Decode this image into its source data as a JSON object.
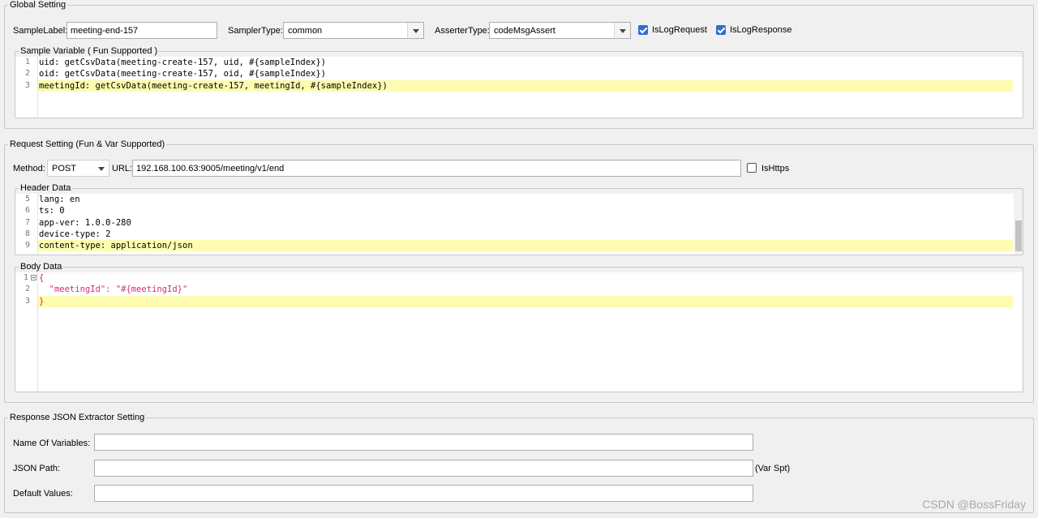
{
  "global": {
    "title": "Global Setting",
    "sample_label": {
      "label": "SampleLabel:",
      "value": "meeting-end-157"
    },
    "sampler_type": {
      "label": "SamplerType:",
      "value": "common"
    },
    "asserter_type": {
      "label": "AsserterType:",
      "value": "codeMsgAssert"
    },
    "is_log_request": {
      "label": "IsLogRequest",
      "checked": true
    },
    "is_log_response": {
      "label": "IsLogResponse",
      "checked": true
    },
    "sample_variable": {
      "title": "Sample Variable ( Fun Supported )",
      "line_numbers": [
        "1",
        "2",
        "3"
      ],
      "lines": [
        "uid: getCsvData(meeting-create-157, uid, #{sampleIndex})",
        "oid: getCsvData(meeting-create-157, oid, #{sampleIndex})",
        "meetingId: getCsvData(meeting-create-157, meetingId, #{sampleIndex})"
      ]
    }
  },
  "request": {
    "title": "Request Setting (Fun & Var Supported)",
    "method": {
      "label": "Method:",
      "value": "POST"
    },
    "url": {
      "label": "URL:",
      "value": "192.168.100.63:9005/meeting/v1/end"
    },
    "is_https": {
      "label": "IsHttps",
      "checked": false
    },
    "header_data": {
      "title": "Header Data",
      "line_numbers": [
        "5",
        "6",
        "7",
        "8",
        "9"
      ],
      "lines": [
        "lang: en",
        "ts: 0",
        "app-ver: 1.0.0-280",
        "device-type: 2",
        "content-type: application/json"
      ]
    },
    "body_data": {
      "title": "Body Data",
      "line_numbers": [
        "1",
        "2",
        "3"
      ],
      "lines": [
        "{",
        "  \"meetingId\": \"#{meetingId}\"",
        "}"
      ]
    }
  },
  "extractor": {
    "title": "Response JSON Extractor Setting",
    "name_of_variables": {
      "label": "Name Of Variables:",
      "value": ""
    },
    "json_path": {
      "label": "JSON Path:",
      "value": "",
      "suffix": "(Var Spt)"
    },
    "default_values": {
      "label": "Default Values:",
      "value": ""
    }
  },
  "watermark": "CSDN @BossFriday",
  "colors": {
    "checkbox_checked": "#2f6dd3",
    "current_line": "#fdfcb0",
    "keyword": "#7b2ea8",
    "string": "#d32e7a"
  }
}
